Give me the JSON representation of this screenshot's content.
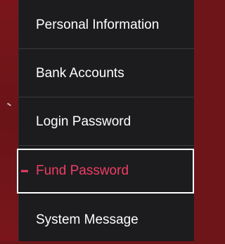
{
  "menu": {
    "items": [
      {
        "label": "Personal Information",
        "active": false
      },
      {
        "label": "Bank Accounts",
        "active": false
      },
      {
        "label": "Login Password",
        "active": false
      },
      {
        "label": "Fund Password",
        "active": true
      },
      {
        "label": "System Message",
        "active": false
      }
    ],
    "active_color": "#ef3d63",
    "text_color": "#ffffff",
    "background_color": "#1c1c1f"
  },
  "page_background_color": "#6e1519"
}
